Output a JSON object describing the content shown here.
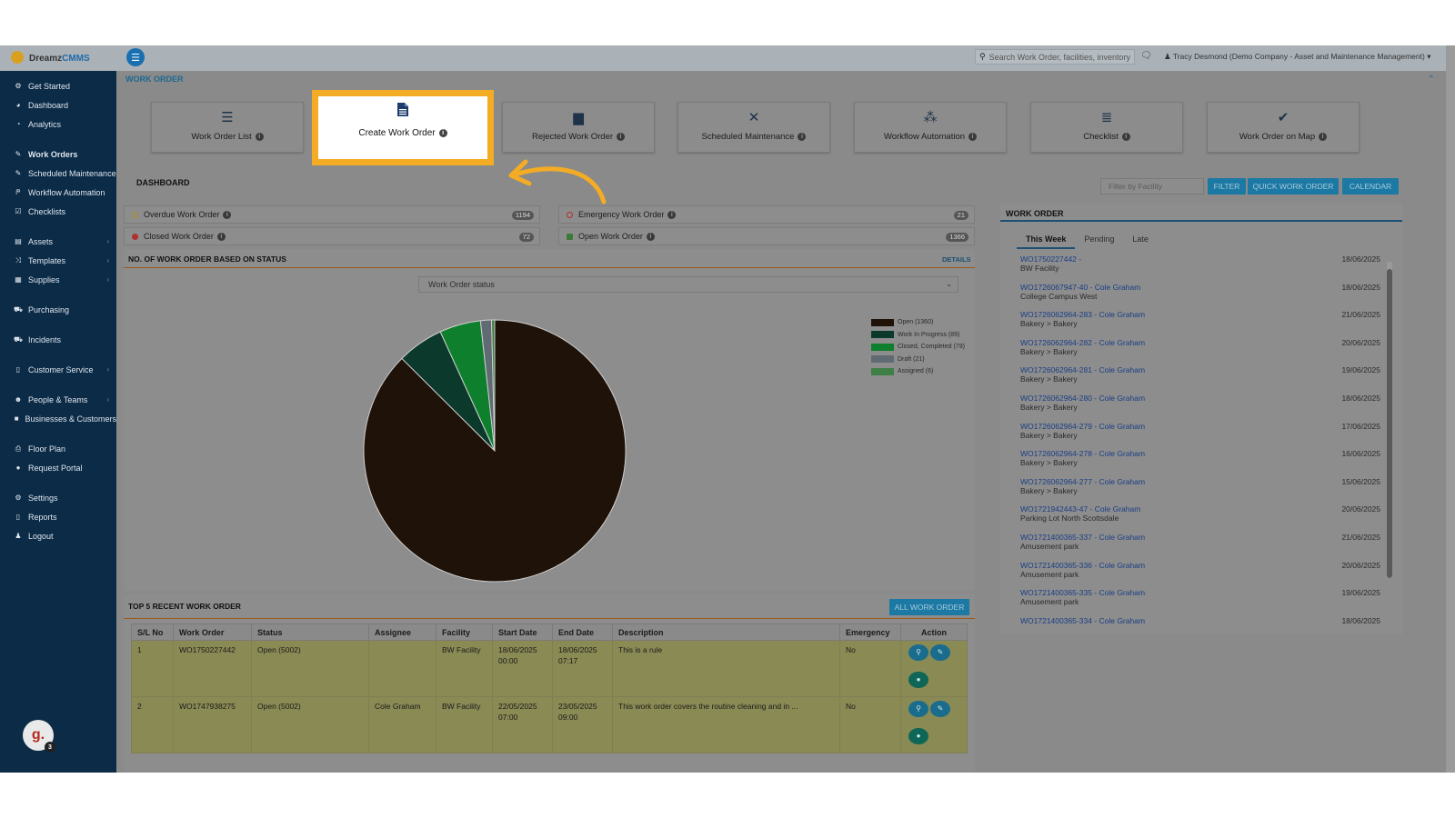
{
  "app": {
    "brand_a": "Dreamz",
    "brand_b": "CMMS"
  },
  "sidebar": {
    "items": [
      {
        "label": "Get Started",
        "icon": "gears-icon"
      },
      {
        "label": "Dashboard",
        "icon": "dashboard-icon"
      },
      {
        "label": "Analytics",
        "icon": "analytics-icon"
      },
      {
        "label": "Work Orders",
        "icon": "wrench-icon"
      },
      {
        "label": "Scheduled Maintenance",
        "icon": "wrench-icon"
      },
      {
        "label": "Workflow Automation",
        "icon": "workflow-icon"
      },
      {
        "label": "Checklists",
        "icon": "checkbox-icon"
      },
      {
        "label": "Assets",
        "icon": "assets-icon"
      },
      {
        "label": "Templates",
        "icon": "shuffle-icon"
      },
      {
        "label": "Supplies",
        "icon": "cubes-icon"
      },
      {
        "label": "Purchasing",
        "icon": "cart-icon"
      },
      {
        "label": "Incidents",
        "icon": "cart-icon"
      },
      {
        "label": "Customer Service",
        "icon": "file-icon"
      },
      {
        "label": "People & Teams",
        "icon": "users-icon"
      },
      {
        "label": "Businesses & Customers",
        "icon": "video-icon"
      },
      {
        "label": "Floor Plan",
        "icon": "print-icon"
      },
      {
        "label": "Request Portal",
        "icon": "comment-icon"
      },
      {
        "label": "Settings",
        "icon": "gear-icon"
      },
      {
        "label": "Reports",
        "icon": "file-icon"
      },
      {
        "label": "Logout",
        "icon": "user-icon"
      }
    ],
    "avatar_letter": "g.",
    "avatar_badge": "3"
  },
  "topbar": {
    "search_placeholder": "Search Work Order, facilities, inventory",
    "user": "Tracy Desmond (Demo Company - Asset and Maintenance Management)"
  },
  "section_title": "WORK ORDER",
  "cards": [
    {
      "label": "Work Order List",
      "icon": "list-icon"
    },
    {
      "label": "Create Work Order",
      "icon": "document-icon"
    },
    {
      "label": "Rejected Work Order",
      "icon": "trash-list-icon"
    },
    {
      "label": "Scheduled Maintenance",
      "icon": "tools-icon"
    },
    {
      "label": "Workflow Automation",
      "icon": "nodes-icon"
    },
    {
      "label": "Checklist",
      "icon": "checklist-icon"
    },
    {
      "label": "Work Order on Map",
      "icon": "map-check-icon"
    }
  ],
  "dashboard": {
    "title": "DASHBOARD",
    "filter_placeholder": "Filter by Facility",
    "filter_btn": "FILTER",
    "quick_btn": "QUICK WORK ORDER",
    "calendar_btn": "CALENDAR",
    "stats": [
      {
        "label": "Overdue Work Order",
        "count": "1194",
        "color": "#b08a20"
      },
      {
        "label": "Emergency Work Order",
        "count": "21",
        "color": "#b03030"
      },
      {
        "label": "Closed Work Order",
        "count": "72",
        "color": "#b03030"
      },
      {
        "label": "Open Work Order",
        "count": "1366",
        "color": "#3a7a3a"
      }
    ]
  },
  "status_chart_panel": {
    "title": "NO. OF WORK ORDER BASED ON STATUS",
    "details": "DETAILS",
    "select_value": "Work Order status"
  },
  "chart_data": {
    "type": "pie",
    "categories": [
      "Open",
      "Work In Progress",
      "Closed, Completed",
      "Draft",
      "Assigned"
    ],
    "values": [
      1360,
      89,
      79,
      21,
      6
    ],
    "legend_labels": [
      "Open (1360)",
      "Work In Progress (89)",
      "Closed, Completed (79)",
      "Draft (21)",
      "Assigned (6)"
    ],
    "colors": [
      "#1f1208",
      "#0b3a2c",
      "#0e7f2c",
      "#5f6a73",
      "#3f7f46"
    ],
    "legend": "right"
  },
  "recent": {
    "title": "TOP 5 RECENT WORK ORDER",
    "all_btn": "ALL WORK ORDER",
    "headers": [
      "S/L No",
      "Work Order",
      "Status",
      "Assignee",
      "Facility",
      "Start Date",
      "End Date",
      "Description",
      "Emergency",
      "Action"
    ],
    "rows": [
      {
        "sl": "1",
        "wo": "WO1750227442",
        "status": "Open (5002)",
        "assignee": "",
        "facility": "BW Facility",
        "start": "18/06/2025 00:00",
        "end": "18/06/2025 07:17",
        "desc": "This is a rule",
        "emergency": "No"
      },
      {
        "sl": "2",
        "wo": "WO1747938275",
        "status": "Open (5002)",
        "assignee": "Cole Graham",
        "facility": "BW Facility",
        "start": "22/05/2025 07:00",
        "end": "23/05/2025 09:00",
        "desc": "This work order covers the routine cleaning and in ...",
        "emergency": "No"
      }
    ]
  },
  "work_order_panel": {
    "title": "WORK ORDER",
    "tabs": [
      "This Week",
      "Pending",
      "Late"
    ],
    "items": [
      {
        "id": "WO1750227442 -",
        "facility": "BW Facility",
        "date": "18/06/2025"
      },
      {
        "id": "WO1726067947-40 - Cole Graham",
        "facility": "College Campus West",
        "date": "18/06/2025"
      },
      {
        "id": "WO1726062964-283 - Cole Graham",
        "facility": "Bakery > Bakery",
        "date": "21/06/2025"
      },
      {
        "id": "WO1726062964-282 - Cole Graham",
        "facility": "Bakery > Bakery",
        "date": "20/06/2025"
      },
      {
        "id": "WO1726062964-281 - Cole Graham",
        "facility": "Bakery > Bakery",
        "date": "19/06/2025"
      },
      {
        "id": "WO1726062964-280 - Cole Graham",
        "facility": "Bakery > Bakery",
        "date": "18/06/2025"
      },
      {
        "id": "WO1726062964-279 - Cole Graham",
        "facility": "Bakery > Bakery",
        "date": "17/06/2025"
      },
      {
        "id": "WO1726062964-278 - Cole Graham",
        "facility": "Bakery > Bakery",
        "date": "16/06/2025"
      },
      {
        "id": "WO1726062964-277 - Cole Graham",
        "facility": "Bakery > Bakery",
        "date": "15/06/2025"
      },
      {
        "id": "WO1721942443-47 - Cole Graham",
        "facility": "Parking Lot North Scottsdale",
        "date": "20/06/2025"
      },
      {
        "id": "WO1721400365-337 - Cole Graham",
        "facility": "Amusement park",
        "date": "21/06/2025"
      },
      {
        "id": "WO1721400365-336 - Cole Graham",
        "facility": "Amusement park",
        "date": "20/06/2025"
      },
      {
        "id": "WO1721400365-335 - Cole Graham",
        "facility": "Amusement park",
        "date": "19/06/2025"
      },
      {
        "id": "WO1721400365-334 - Cole Graham",
        "facility": "",
        "date": "18/06/2025"
      }
    ]
  }
}
